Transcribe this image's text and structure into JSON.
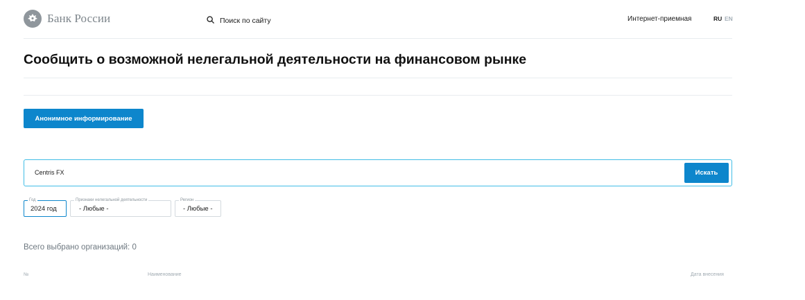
{
  "header": {
    "logo_text": "Банк России",
    "logo_icon": "eagle-emblem-icon",
    "search_label": "Поиск по сайту",
    "search_icon": "search-icon",
    "reception_label": "Интернет-приемная",
    "lang_ru": "RU",
    "lang_en": "EN"
  },
  "page": {
    "title": "Сообщить о возможной нелегальной деятельности на финансовом рынке",
    "anon_button_label": "Анонимное информирование"
  },
  "search": {
    "value": "Centris FX",
    "button_label": "Искать"
  },
  "filters": {
    "year": {
      "legend": "Год",
      "value": "2024 год"
    },
    "signs": {
      "legend": "Признаки нелегальной деятельности",
      "value": "- Любые -"
    },
    "region": {
      "legend": "Регион",
      "value": "- Любые -"
    }
  },
  "results": {
    "total_label": "Всего выбрано организаций: 0",
    "columns": [
      "№",
      "Наименование",
      "Дата внесения"
    ]
  },
  "colors": {
    "accent": "#0d86cc",
    "search_border": "#40bde6",
    "muted_text": "#a1abb2"
  }
}
